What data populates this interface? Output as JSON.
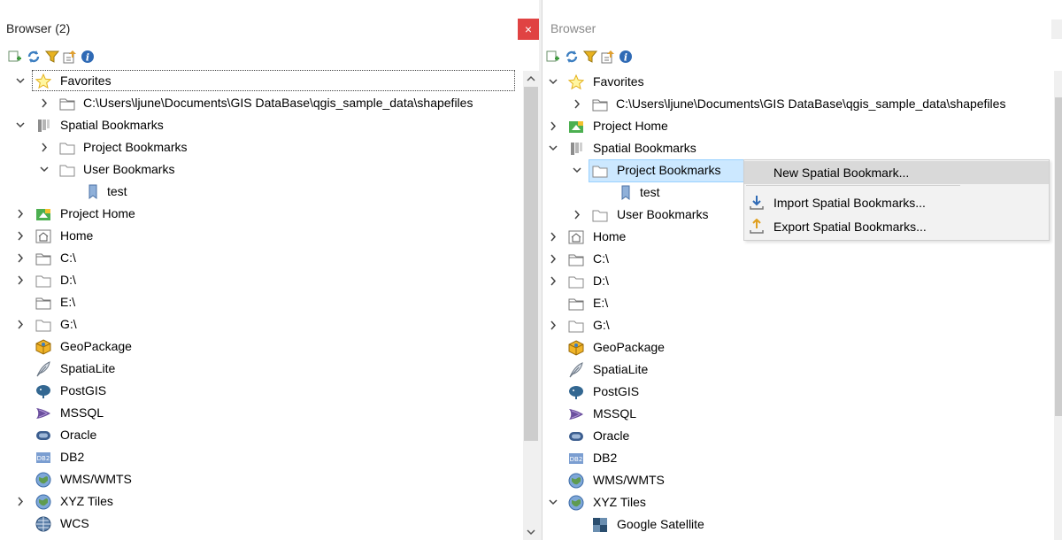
{
  "left": {
    "title": "Browser (2)",
    "close_glyph": "×",
    "tree": {
      "favorites": "Favorites",
      "favorite_path": "C:\\Users\\ljune\\Documents\\GIS DataBase\\qgis_sample_data\\shapefiles",
      "spatial_bookmarks": "Spatial Bookmarks",
      "project_bookmarks": "Project Bookmarks",
      "user_bookmarks": "User Bookmarks",
      "test": "test",
      "project_home": "Project Home",
      "home": "Home",
      "c_drive": "C:\\",
      "d_drive": "D:\\",
      "e_drive": "E:\\",
      "g_drive": "G:\\",
      "geopackage": "GeoPackage",
      "spatialite": "SpatiaLite",
      "postgis": "PostGIS",
      "mssql": "MSSQL",
      "oracle": "Oracle",
      "db2": "DB2",
      "wms": "WMS/WMTS",
      "xyz": "XYZ Tiles",
      "wcs": "WCS"
    }
  },
  "right": {
    "title": "Browser",
    "tree": {
      "favorites": "Favorites",
      "favorite_path": "C:\\Users\\ljune\\Documents\\GIS DataBase\\qgis_sample_data\\shapefiles",
      "project_home": "Project Home",
      "spatial_bookmarks": "Spatial Bookmarks",
      "project_bookmarks": "Project Bookmarks",
      "test": "test",
      "user_bookmarks": "User Bookmarks",
      "home": "Home",
      "c_drive": "C:\\",
      "d_drive": "D:\\",
      "e_drive": "E:\\",
      "g_drive": "G:\\",
      "geopackage": "GeoPackage",
      "spatialite": "SpatiaLite",
      "postgis": "PostGIS",
      "mssql": "MSSQL",
      "oracle": "Oracle",
      "db2": "DB2",
      "wms": "WMS/WMTS",
      "xyz": "XYZ Tiles",
      "google_satellite": "Google Satellite"
    },
    "context_menu": {
      "new_bookmark": "New Spatial Bookmark...",
      "import_bookmarks": "Import Spatial Bookmarks...",
      "export_bookmarks": "Export Spatial Bookmarks..."
    }
  },
  "colors": {
    "close_red": "#e04343",
    "selection_blue": "#cce8ff",
    "menu_bg": "#f2f2f2"
  },
  "db2_badge": "DB2"
}
